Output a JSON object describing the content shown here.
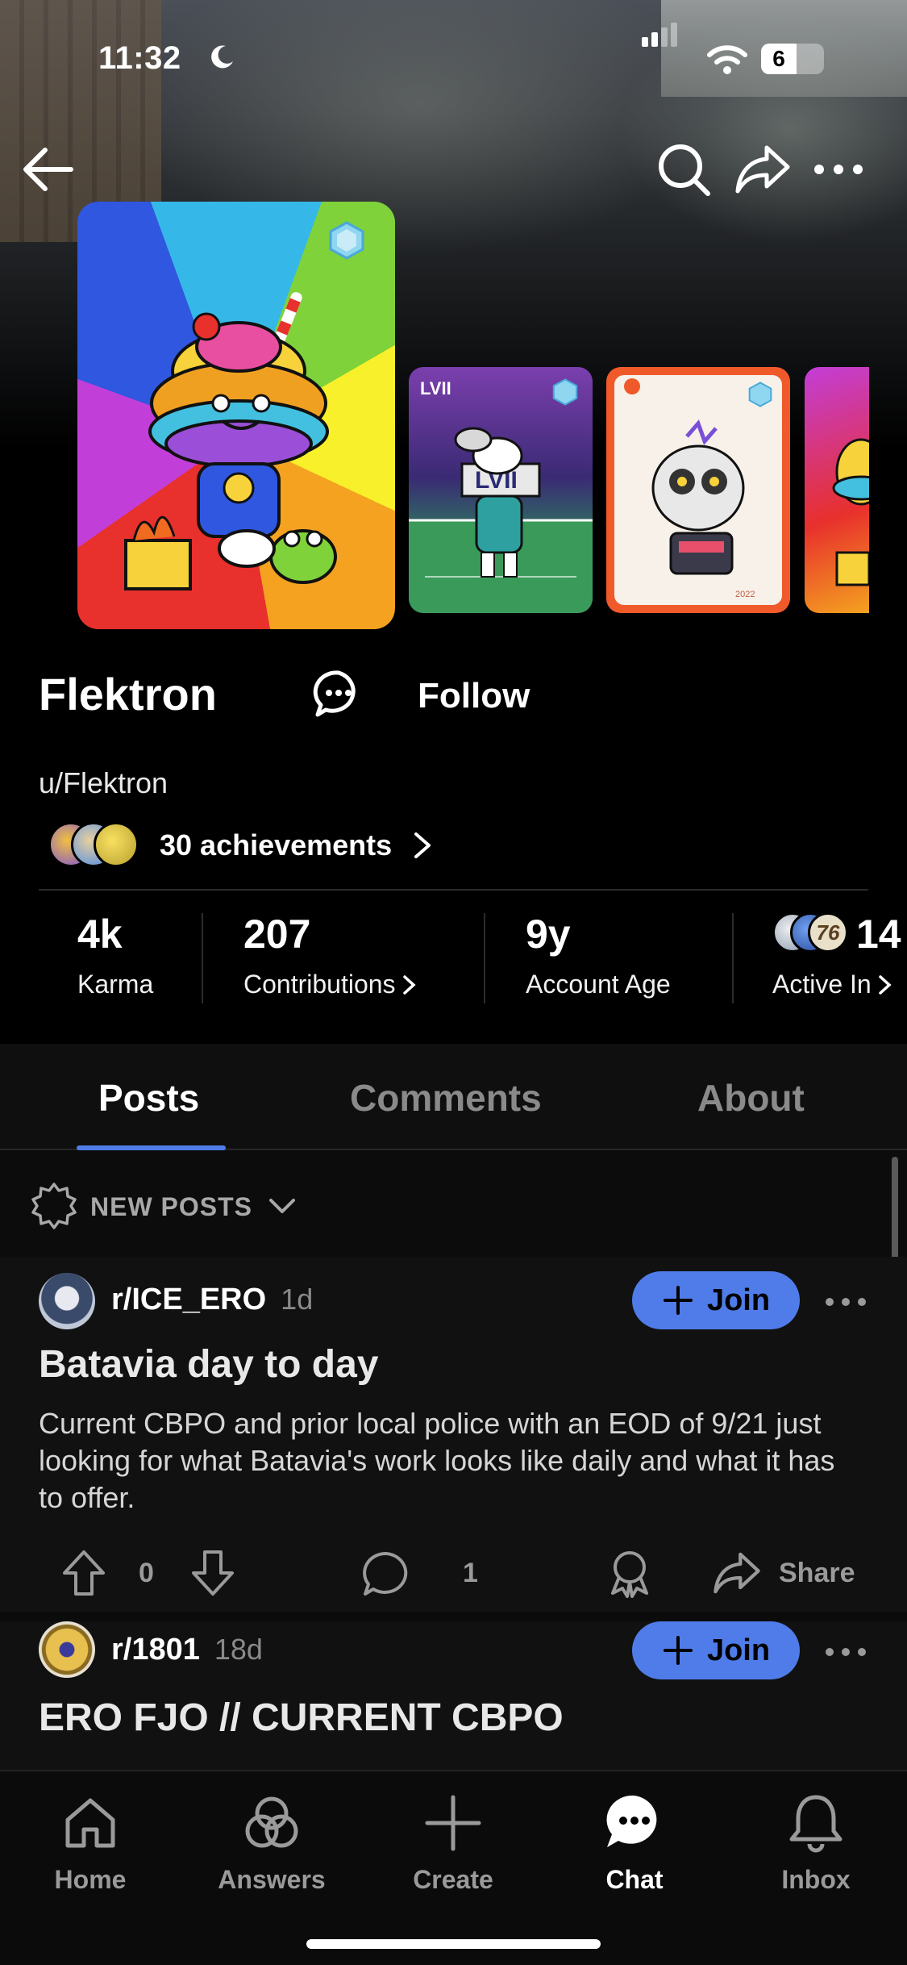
{
  "status_bar": {
    "time": "11:32",
    "battery": "6"
  },
  "header": {
    "back_icon": "arrow-left-icon",
    "search_icon": "search-icon",
    "share_icon": "share-icon",
    "more_icon": "ellipsis-icon"
  },
  "profile": {
    "display_name": "Flektron",
    "follow_label": "Follow",
    "username": "u/Flektron",
    "achievements_label": "30 achievements"
  },
  "stats": {
    "karma_value": "4k",
    "karma_label": "Karma",
    "contributions_value": "207",
    "contributions_label": "Contributions",
    "age_value": "9y",
    "age_label": "Account Age",
    "active_value": "14",
    "active_label": "Active In",
    "active_badge_text": "76"
  },
  "tabs": [
    {
      "label": "Posts"
    },
    {
      "label": "Comments"
    },
    {
      "label": "About"
    }
  ],
  "sort": {
    "label": "NEW POSTS"
  },
  "posts": [
    {
      "subreddit": "r/ICE_ERO",
      "age": "1d",
      "join_label": "Join",
      "title": "Batavia day to day",
      "body": "Current CBPO and prior local police with an EOD of 9/21 just looking for what Batavia's work looks like daily and what it has to offer.",
      "upvotes": "0",
      "comments": "1",
      "share_label": "Share"
    },
    {
      "subreddit": "r/1801",
      "age": "18d",
      "join_label": "Join",
      "title": "ERO FJO // CURRENT CBPO"
    }
  ],
  "bottom_nav": [
    {
      "label": "Home",
      "icon": "home-icon"
    },
    {
      "label": "Answers",
      "icon": "answers-icon"
    },
    {
      "label": "Create",
      "icon": "plus-icon"
    },
    {
      "label": "Chat",
      "icon": "chat-icon"
    },
    {
      "label": "Inbox",
      "icon": "bell-icon"
    }
  ],
  "colors": {
    "accent": "#4f7ce8",
    "background": "#000000",
    "feed_background": "#111111",
    "muted_text": "#8a8a8a"
  }
}
